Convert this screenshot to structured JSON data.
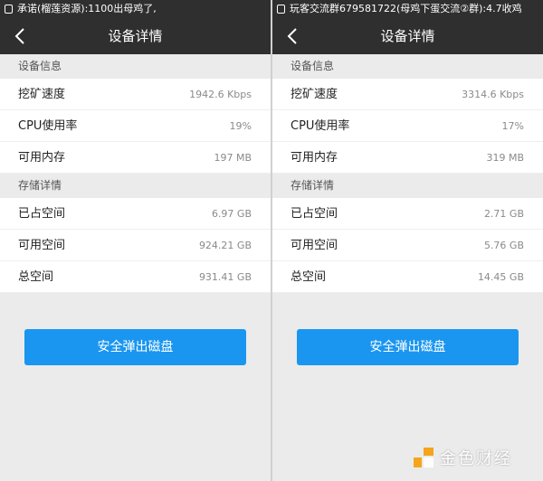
{
  "colors": {
    "header_bg": "#2f2f2f",
    "page_bg": "#ebebeb",
    "accent": "#1a96f0",
    "watermark_accent": "#f4a51c"
  },
  "panels": [
    {
      "statusbar": {
        "text": "承诺(榴莲资源):1100出母鸡了,"
      },
      "titlebar": {
        "back_icon": "chevron-left-icon",
        "title": "设备详情"
      },
      "device_info": {
        "header": "设备信息",
        "rows": [
          {
            "label": "挖矿速度",
            "value": "1942.6 Kbps"
          },
          {
            "label": "CPU使用率",
            "value": "19%"
          },
          {
            "label": "可用内存",
            "value": "197 MB"
          }
        ]
      },
      "storage": {
        "header": "存储详情",
        "rows": [
          {
            "label": "已占空间",
            "value": "6.97 GB"
          },
          {
            "label": "可用空间",
            "value": "924.21 GB"
          },
          {
            "label": "总空间",
            "value": "931.41 GB"
          }
        ]
      },
      "eject_button": "安全弹出磁盘"
    },
    {
      "statusbar": {
        "text": "玩客交流群679581722(母鸡下蛋交流②群):4.7收鸡"
      },
      "titlebar": {
        "back_icon": "chevron-left-icon",
        "title": "设备详情"
      },
      "device_info": {
        "header": "设备信息",
        "rows": [
          {
            "label": "挖矿速度",
            "value": "3314.6 Kbps"
          },
          {
            "label": "CPU使用率",
            "value": "17%"
          },
          {
            "label": "可用内存",
            "value": "319 MB"
          }
        ]
      },
      "storage": {
        "header": "存储详情",
        "rows": [
          {
            "label": "已占空间",
            "value": "2.71 GB"
          },
          {
            "label": "可用空间",
            "value": "5.76 GB"
          },
          {
            "label": "总空间",
            "value": "14.45 GB"
          }
        ]
      },
      "eject_button": "安全弹出磁盘"
    }
  ],
  "watermark": {
    "logo_icon": "jinse-logo-icon",
    "text": "金色财经"
  }
}
